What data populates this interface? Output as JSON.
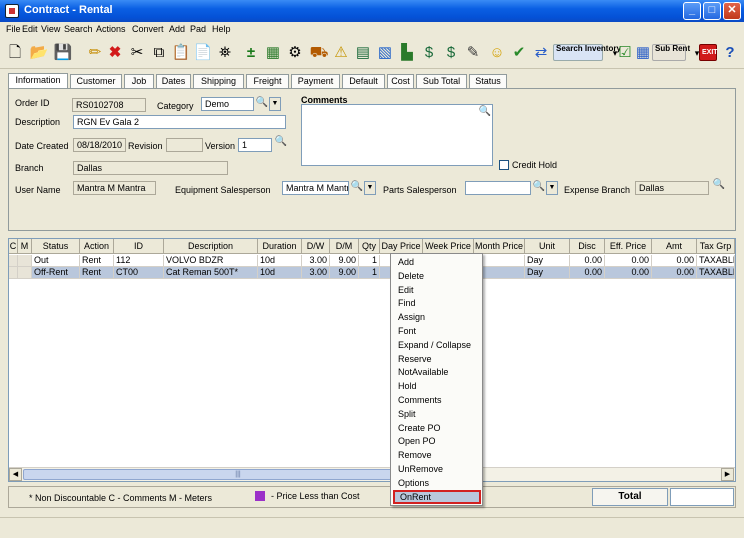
{
  "window": {
    "title": "Contract - Rental"
  },
  "menu": [
    "File",
    "Edit",
    "View",
    "Search",
    "Actions",
    "Convert",
    "Add",
    "Pad",
    "Help"
  ],
  "toolbar": {
    "search_inventory": "Search Inventory",
    "sub_rent": "Sub Rent",
    "exit": "EXIT"
  },
  "tabs": [
    "Information",
    "Customer",
    "Job",
    "Dates",
    "Shipping",
    "Freight",
    "Payment",
    "Default",
    "Cost",
    "Sub Total",
    "Status"
  ],
  "form": {
    "order_id_label": "Order ID",
    "order_id": "RS0102708",
    "category_label": "Category",
    "category": "Demo",
    "description_label": "Description",
    "description": "RGN Ev Gala 2",
    "date_created_label": "Date Created",
    "date_created": "08/18/2010",
    "revision_label": "Revision",
    "revision": "",
    "version_label": "Version",
    "version": "1",
    "branch_label": "Branch",
    "branch": "Dallas",
    "comments_label": "Comments",
    "comments": "",
    "credit_hold_label": "Credit Hold",
    "user_name_label": "User Name",
    "user_name": "Mantra M Mantra",
    "equip_sales_label": "Equipment Salesperson",
    "equip_sales": "Mantra M Mantra",
    "parts_sales_label": "Parts Salesperson",
    "parts_sales": "",
    "expense_branch_label": "Expense Branch",
    "expense_branch": "Dallas"
  },
  "grid": {
    "headers": [
      "C",
      "M",
      "Status",
      "Action",
      "ID",
      "Description",
      "Duration",
      "D/W",
      "D/M",
      "Qty",
      "Day Price",
      "Week Price",
      "Month Price",
      "Unit",
      "Disc",
      "Eff. Price",
      "Amt",
      "Tax Grp"
    ],
    "rows": [
      [
        "",
        "",
        "Out",
        "Rent",
        "112",
        "VOLVO BDZR",
        "10d",
        "3.00",
        "9.00",
        "1",
        "",
        "",
        "",
        "Day",
        "0.00",
        "0.00",
        "0.00",
        "TAXABLE"
      ],
      [
        "",
        "",
        "Off-Rent",
        "Rent",
        "CT00",
        "Cat Reman 500T*",
        "10d",
        "3.00",
        "9.00",
        "1",
        "",
        "",
        "",
        "Day",
        "0.00",
        "0.00",
        "0.00",
        "TAXABLE"
      ]
    ],
    "scroll_marker": "|||"
  },
  "context_menu": [
    "Add",
    "Delete",
    "Edit",
    "Find",
    "Assign",
    "Font",
    "Expand / Collapse",
    "Reserve",
    "NotAvailable",
    "Hold",
    "Comments",
    "Split",
    "Create PO",
    "Open PO",
    "Remove",
    "UnRemove",
    "Options",
    "OnRent"
  ],
  "context_menu_selected": "OnRent",
  "footer": {
    "legend": "* Non Discountable  C - Comments  M - Meters",
    "price_less_than_cost": "- Price Less than Cost",
    "price_less_color": "#9b30c8",
    "total_label": "Total"
  }
}
